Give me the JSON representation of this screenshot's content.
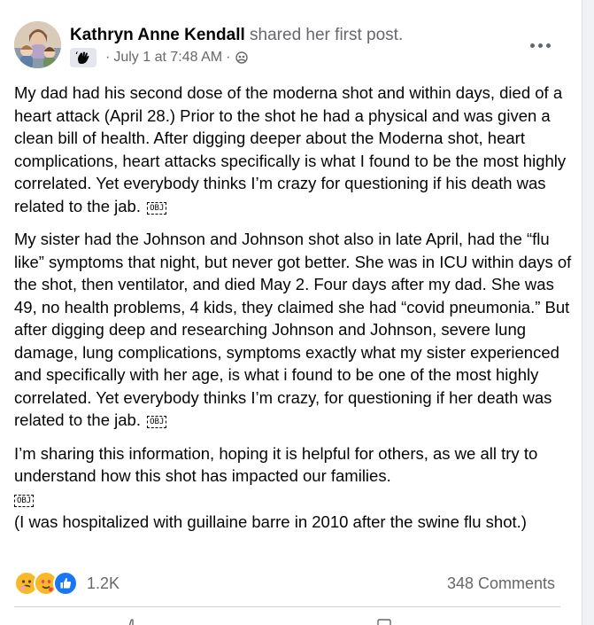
{
  "post": {
    "author": "Kathryn Anne Kendall",
    "action": "shared her first post.",
    "timestamp": "July 1 at 7:48 AM",
    "separator": "·",
    "badge_icon": "waving-hand-badge-icon",
    "audience_icon": "friends-audience-icon",
    "paragraphs": {
      "p1": "My dad had his second dose of the moderna shot and within days, died of a heart attack (April 28.) Prior to the shot he had a physical and was given a clean bill of health. After digging deeper about the Moderna shot, heart complications, heart attacks specifically is what I found to be the most highly correlated.  Yet everybody thinks I’m crazy for questioning if his death was related to the jab.",
      "p2": "My sister had the Johnson and Johnson shot also in late April, had the “flu like” symptoms that night, but never got better. She was in ICU within days of the shot, then ventilator, and died May 2. Four days after my dad. She was 49, no health problems, 4 kids, they claimed she had “covid pneumonia.” But after digging deep and researching Johnson and Johnson, severe lung damage, lung complications, symptoms exactly what my sister experienced and specifically with her age, is what i found to be one of the most highly correlated. Yet everybody thinks I’m crazy, for questioning if her death was related to the jab.",
      "p3": "I’m sharing this information, hoping it is helpful for others, as we all try to understand how this shot has impacted our families.",
      "p4": "(I was hospitalized with guillaine barre in 2010 after the swine flu shot.)"
    },
    "obj_placeholder": "OBJ"
  },
  "engagement": {
    "reaction_icons": [
      "care-emoji-icon",
      "love-emoji-icon",
      "like-emoji-icon"
    ],
    "reaction_count": "1.2K",
    "comments": "348 Comments"
  },
  "colors": {
    "text": "#050505",
    "secondary": "#65676b",
    "like_blue": "#1877f2",
    "love_red": "#f33e58",
    "care_yellow": "#f7b928"
  }
}
